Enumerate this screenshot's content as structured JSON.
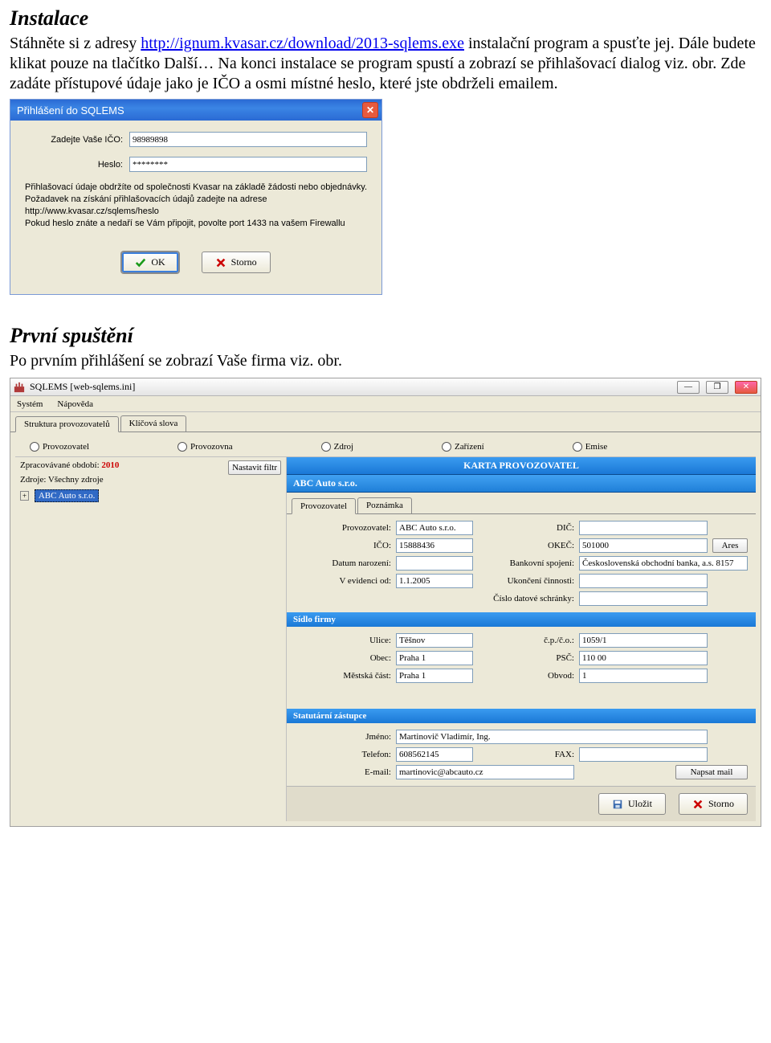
{
  "doc": {
    "h1": "Instalace",
    "p1_a": "Stáhněte si z adresy ",
    "p1_link": "http://ignum.kvasar.cz/download/2013-sqlems.exe",
    "p1_b": " instalační program a spusťte jej. Dále budete klikat pouze na tlačítko Další… Na konci instalace se program spustí a zobrazí se přihlašovací dialog viz. obr. Zde zadáte přístupové údaje jako je IČO a osmi místné heslo, které jste obdrželi emailem.",
    "h2": "První spuštění",
    "p2": "Po prvním přihlášení se zobrazí Vaše firma viz. obr."
  },
  "login": {
    "title": "Přihlášení do SQLEMS",
    "ico_label": "Zadejte Vaše IČO:",
    "ico_value": "98989898",
    "pwd_label": "Heslo:",
    "pwd_value": "********",
    "info": "Přihlašovací údaje  obdržíte od společnosti Kvasar na základě  žádosti nebo objednávky. Požadavek na získání přihlašovacích údajů  zadejte na adrese http://www.kvasar.cz/sqlems/heslo\nPokud heslo znáte a nedaří se Vám připojit, povolte port 1433 na vašem Firewallu",
    "ok": "OK",
    "storno": "Storno"
  },
  "app": {
    "title": "SQLEMS [web-sqlems.ini]",
    "menu": {
      "system": "Systém",
      "help": "Nápověda"
    },
    "tabs": {
      "struktura": "Struktura provozovatelů",
      "klicova": "Klíčová slova"
    },
    "radios": {
      "provozovatel": "Provozovatel",
      "provozovna": "Provozovna",
      "zdroj": "Zdroj",
      "zarizeni": "Zařízení",
      "emise": "Emise"
    },
    "period_label": "Zpracovávané období: ",
    "period_year": "2010",
    "zdroje": "Zdroje: Všechny zdroje",
    "filter_btn": "Nastavit filtr",
    "tree_item": "ABC Auto s.r.o.",
    "card_title": "KARTA PROVOZOVATEL",
    "card_sub": "ABC Auto s.r.o.",
    "inner_tabs": {
      "prov": "Provozovatel",
      "pozn": "Poznámka"
    },
    "fields": {
      "provozovatel_l": "Provozovatel:",
      "provozovatel_v": "ABC Auto s.r.o.",
      "dic_l": "DIČ:",
      "dic_v": "",
      "ico_l": "IČO:",
      "ico_v": "15888436",
      "okec_l": "OKEČ:",
      "okec_v": "501000",
      "ares": "Ares",
      "datum_l": "Datum narození:",
      "datum_v": "",
      "bank_l": "Bankovní spojení:",
      "bank_v": "Československá obchodní banka, a.s. 8157",
      "evid_l": "V evidenci od:",
      "evid_v": "1.1.2005",
      "ukonc_l": "Ukončení činnosti:",
      "ukonc_v": "",
      "cds_l": "Číslo datové schránky:",
      "cds_v": ""
    },
    "sidlo": {
      "title": "Sídlo firmy",
      "ulice_l": "Ulice:",
      "ulice_v": "Těšnov",
      "cp_l": "č.p./č.o.:",
      "cp_v": "1059/1",
      "obec_l": "Obec:",
      "obec_v": "Praha 1",
      "psc_l": "PSČ:",
      "psc_v": "110 00",
      "mcast_l": "Městská část:",
      "mcast_v": "Praha 1",
      "obvod_l": "Obvod:",
      "obvod_v": "1"
    },
    "stat": {
      "title": "Statutární zástupce",
      "jmeno_l": "Jméno:",
      "jmeno_v": "Martinovič Vladimír, Ing.",
      "tel_l": "Telefon:",
      "tel_v": "608562145",
      "fax_l": "FAX:",
      "fax_v": "",
      "email_l": "E-mail:",
      "email_v": "martinovic@abcauto.cz",
      "mail_btn": "Napsat mail"
    },
    "save": "Uložit",
    "storno": "Storno"
  }
}
